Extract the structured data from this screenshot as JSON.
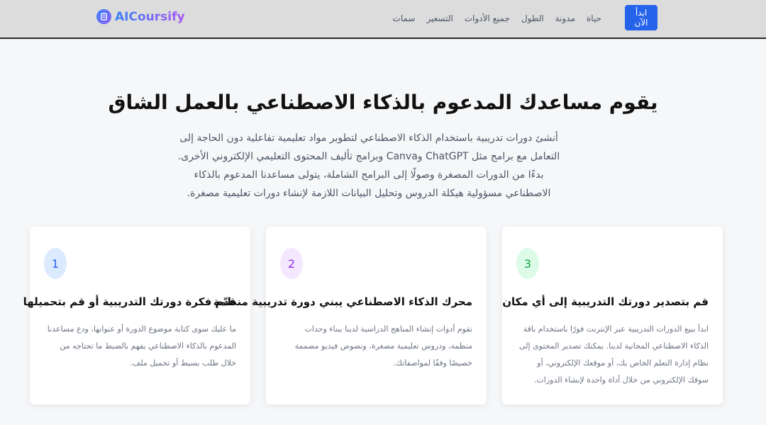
{
  "nav": {
    "brand": "AICoursify",
    "links": [
      "حياة",
      "مدونة",
      "الطول",
      "جميع الأدوات",
      "التسعير",
      "سمات"
    ],
    "cta_label": "ابدأ الآن"
  },
  "hero": {
    "title": "يقوم مساعدك المدعوم بالذكاء الاصطناعي بالعمل الشاق",
    "description": "أنشئ دورات تدريبية باستخدام الذكاء الاصطناعي لتطوير مواد تعليمية تفاعلية دون الحاجة إلى التعامل مع برامج مثل ChatGPT وCanva وبرامج تأليف المحتوى التعليمي الإلكتروني الأخرى. بدءًا من الدورات المصغرة وصولًا إلى البرامج الشاملة، يتولى مساعدنا المدعوم بالذكاء الاصطناعي مسؤولية هيكلة الدروس وتحليل البيانات اللازمة لإنشاء دورات تعليمية مصغرة."
  },
  "cards": [
    {
      "number": "1",
      "title": "قدّم فكرة دورتك التدريبية أو قم بتحميلها",
      "description": "ما عليك سوى كتابة موضوع الدورة أو عنوانها، ودع مساعدنا المدعوم بالذكاء الاصطناعي يفهم بالضبط ما تحتاجه من خلال طلب بسيط أو تحميل ملف.",
      "accent_bg": "#dbeafe",
      "accent_fg": "#2563eb"
    },
    {
      "number": "2",
      "title": "محرك الذكاء الاصطناعي يبني دورة تدريبية منظمة",
      "description": "تقوم أدوات إنشاء المناهج الدراسية لدينا ببناء وحدات منظمة، ودروس تعليمية مصغرة، ونصوص فيديو مصممة خصيصًا وفقًا لمواصفاتك.",
      "accent_bg": "#f3e8ff",
      "accent_fg": "#9333ea"
    },
    {
      "number": "3",
      "title": "قم بتصدير دورتك التدريبية إلى أي مكان",
      "description": "ابدأ ببيع الدورات التدريبية عبر الإنترنت فورًا باستخدام باقة الذكاء الاصطناعي المجانية لدينا. يمكنك تصدير المحتوى إلى نظام إدارة التعلم الخاص بك، أو موقعك الإلكتروني، أو سوقك الإلكتروني من خلال أداة واحدة لإنشاء الدورات.",
      "accent_bg": "#dcfce7",
      "accent_fg": "#16a34a"
    }
  ]
}
